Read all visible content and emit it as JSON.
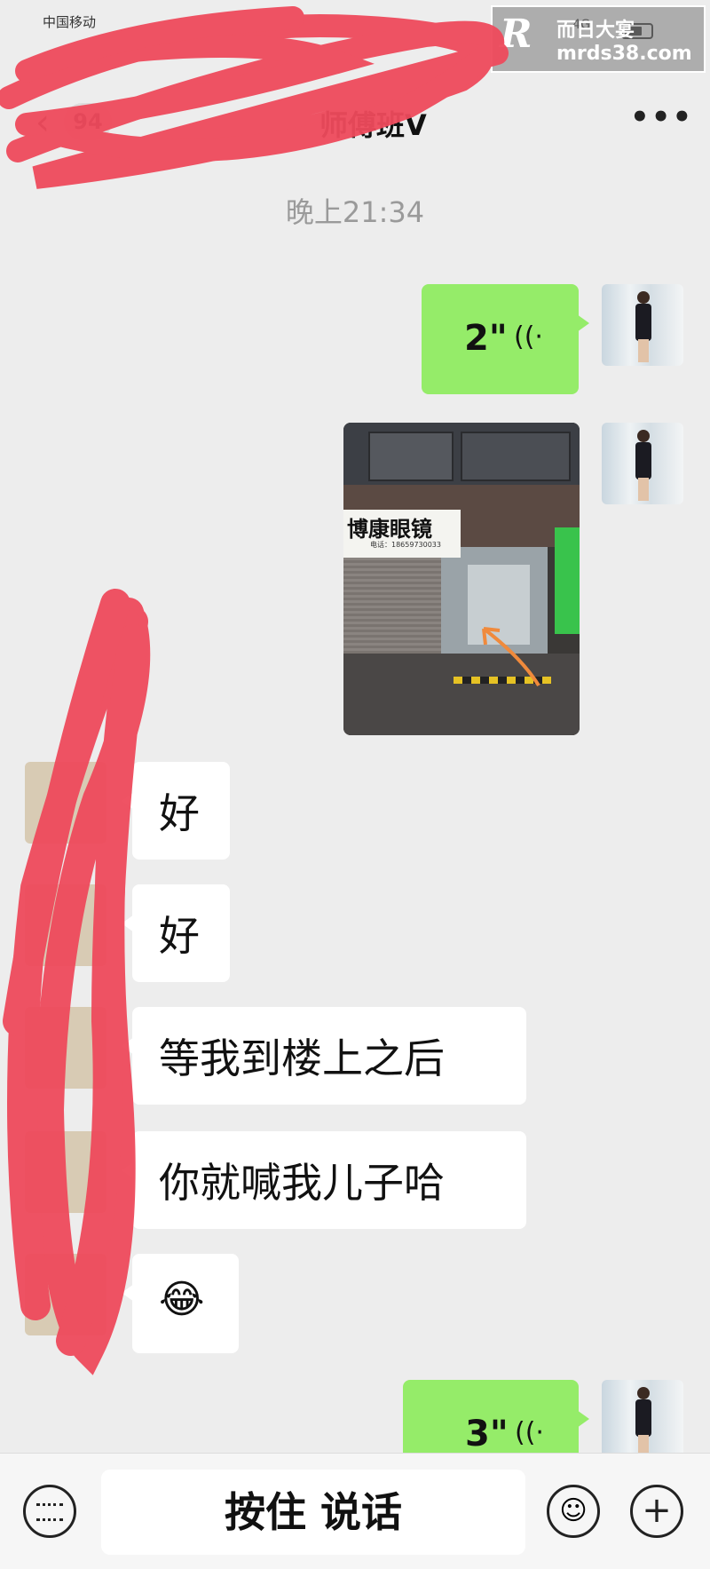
{
  "status_bar": {
    "carrier": "中国移动",
    "network": "4G"
  },
  "watermark": {
    "logo": "R",
    "name": "而日大宴",
    "url": "mrds38.com"
  },
  "header": {
    "back_glyph": "‹",
    "unread_count": "94",
    "title": "师傅班V",
    "more_glyph": "•••"
  },
  "chat": {
    "timestamp": "晚上21:34",
    "messages": [
      {
        "from": "me",
        "type": "voice",
        "duration": "2\""
      },
      {
        "from": "me",
        "type": "image",
        "sign_text": "博康眼镜",
        "sign_phone": "电话：18659730033"
      },
      {
        "from": "other",
        "type": "text",
        "text": "好"
      },
      {
        "from": "other",
        "type": "text",
        "text": "好"
      },
      {
        "from": "other",
        "type": "text",
        "text": "等我到楼上之后"
      },
      {
        "from": "other",
        "type": "text",
        "text": "你就喊我儿子哈"
      },
      {
        "from": "other",
        "type": "text",
        "text": "😂"
      },
      {
        "from": "me",
        "type": "voice",
        "duration": "3\""
      }
    ]
  },
  "input_bar": {
    "talk_label": "按住 说话",
    "emoji_glyph": "☺",
    "plus_glyph": "+"
  },
  "icons": {
    "voice": "voice-wave-icon",
    "keyboard": "keyboard-icon",
    "emoji": "emoji-icon",
    "plus": "plus-icon",
    "back": "back-arrow-icon",
    "more": "more-icon"
  },
  "colors": {
    "bubble_me": "#95ec69",
    "bubble_other": "#ffffff",
    "background": "#ededed",
    "scribble": "#ef4a5c"
  }
}
